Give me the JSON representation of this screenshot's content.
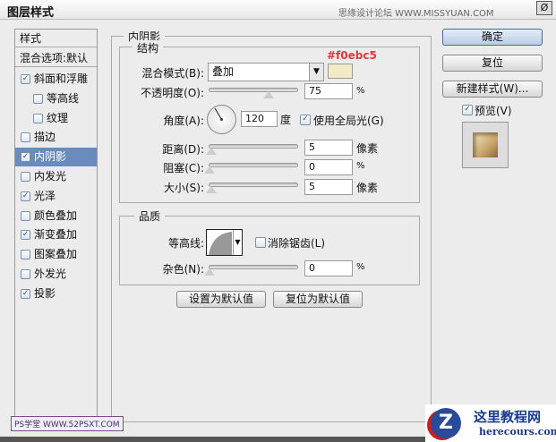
{
  "window": {
    "title": "图层样式",
    "watermark": "思缘设计论坛 WWW.MISSYUAN.COM",
    "close": "Ø"
  },
  "sidebar": {
    "header": "样式",
    "blend": "混合选项:默认",
    "items": [
      {
        "label": "斜面和浮雕",
        "checked": true,
        "sub": false
      },
      {
        "label": "等高线",
        "checked": false,
        "sub": true
      },
      {
        "label": "纹理",
        "checked": false,
        "sub": true
      },
      {
        "label": "描边",
        "checked": false,
        "sub": false
      },
      {
        "label": "内阴影",
        "checked": true,
        "sub": false,
        "selected": true
      },
      {
        "label": "内发光",
        "checked": false,
        "sub": false
      },
      {
        "label": "光泽",
        "checked": true,
        "sub": false
      },
      {
        "label": "颜色叠加",
        "checked": false,
        "sub": false
      },
      {
        "label": "渐变叠加",
        "checked": true,
        "sub": false
      },
      {
        "label": "图案叠加",
        "checked": false,
        "sub": false
      },
      {
        "label": "外发光",
        "checked": false,
        "sub": false
      },
      {
        "label": "投影",
        "checked": true,
        "sub": false
      }
    ]
  },
  "panel": {
    "title": "内阴影",
    "structure": "结构",
    "quality": "品质",
    "blend_label": "混合模式(B):",
    "blend_value": "叠加",
    "color": "#f0ebc5",
    "color_note": "#f0ebc5",
    "opacity_label": "不透明度(O):",
    "opacity": "75",
    "opacity_unit": "%",
    "opacity_frac": 0.75,
    "angle_label": "角度(A):",
    "angle": "120",
    "angle_unit": "度",
    "global_light": "使用全局光(G)",
    "distance_label": "距离(D):",
    "distance": "5",
    "distance_unit": "像素",
    "distance_frac": 0.02,
    "choke_label": "阻塞(C):",
    "choke": "0",
    "choke_unit": "%",
    "choke_frac": 0,
    "size_label": "大小(S):",
    "size": "5",
    "size_unit": "像素",
    "size_frac": 0.02,
    "contour_label": "等高线:",
    "antialias": "消除锯齿(L)",
    "noise_label": "杂色(N):",
    "noise": "0",
    "noise_unit": "%",
    "noise_frac": 0,
    "set_default": "设置为默认值",
    "reset_default": "复位为默认值"
  },
  "right": {
    "ok": "确定",
    "reset": "复位",
    "new_style": "新建样式(W)...",
    "preview": "预览(V)"
  },
  "footer": {
    "ps_logo": "PS学堂 WWW.52PSXT.COM",
    "site_logo": "这里教程网",
    "site_url": "herecours.com"
  }
}
